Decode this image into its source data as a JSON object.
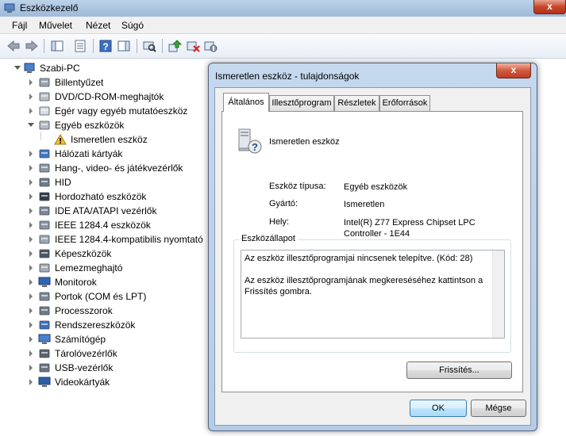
{
  "window": {
    "title": "Eszközkezelő",
    "close_glyph": "x"
  },
  "menu": [
    "Fájl",
    "Művelet",
    "Nézet",
    "Súgó"
  ],
  "toolbar": {
    "icons": [
      "back-icon",
      "forward-icon",
      "show-hide-tree-icon",
      "properties-icon",
      "help-icon",
      "show-hide-action-pane-icon",
      "scan-hardware-changes-icon",
      "update-driver-icon",
      "uninstall-icon",
      "disable-icon"
    ]
  },
  "tree": {
    "root": "Szabi-PC",
    "items": [
      {
        "label": "Billentyűzet",
        "icon": "keyboard-icon"
      },
      {
        "label": "DVD/CD-ROM-meghajtók",
        "icon": "dvd-drive-icon"
      },
      {
        "label": "Egér vagy egyéb mutatóeszköz",
        "icon": "mouse-icon"
      },
      {
        "label": "Egyéb eszközök",
        "icon": "other-devices-icon"
      },
      {
        "label": "Ismeretlen eszköz",
        "icon": "unknown-device-warning-icon"
      },
      {
        "label": "Hálózati kártyák",
        "icon": "network-adapter-icon"
      },
      {
        "label": "Hang-, video- és játékvezérlők",
        "icon": "sound-icon"
      },
      {
        "label": "HID",
        "icon": "hid-icon"
      },
      {
        "label": "Hordozható eszközök",
        "icon": "portable-device-icon"
      },
      {
        "label": "IDE ATA/ATAPI vezérlők",
        "icon": "ide-controller-icon"
      },
      {
        "label": "IEEE 1284.4 eszközök",
        "icon": "ieee-device-icon"
      },
      {
        "label": "IEEE 1284.4-kompatibilis nyomtató",
        "icon": "printer-icon"
      },
      {
        "label": "Képeszközök",
        "icon": "imaging-device-icon"
      },
      {
        "label": "Lemezmeghajtó",
        "icon": "disk-drive-icon"
      },
      {
        "label": "Monitorok",
        "icon": "monitor-icon"
      },
      {
        "label": "Portok (COM és LPT)",
        "icon": "port-icon"
      },
      {
        "label": "Processzorok",
        "icon": "processor-icon"
      },
      {
        "label": "Rendszereszközök",
        "icon": "system-device-icon"
      },
      {
        "label": "Számítógép",
        "icon": "computer-icon"
      },
      {
        "label": "Tárolóvezérlők",
        "icon": "storage-controller-icon"
      },
      {
        "label": "USB-vezérlők",
        "icon": "usb-icon"
      },
      {
        "label": "Videokártyák",
        "icon": "display-adapter-icon"
      }
    ]
  },
  "dialog": {
    "title": "Ismeretlen eszköz - tulajdonságok",
    "close_glyph": "x",
    "tabs": [
      "Általános",
      "Illesztőprogram",
      "Részletek",
      "Erőforrások"
    ],
    "device_name": "Ismeretlen eszköz",
    "props": {
      "type_label": "Eszköz típusa:",
      "type_value": "Egyéb eszközök",
      "maker_label": "Gyártó:",
      "maker_value": "Ismeretlen",
      "location_label": "Hely:",
      "location_value": "Intel(R) Z77 Express Chipset LPC Controller - 1E44"
    },
    "status_legend": "Eszközállapot",
    "status_line1": "Az eszköz illesztőprogramjai nincsenek telepítve. (Kód: 28)",
    "status_line2": "Az eszköz illesztőprogramjának megkereséséhez kattintson a Frissítés gombra.",
    "update_button": "Frissítés...",
    "ok_button": "OK",
    "cancel_button": "Mégse"
  }
}
